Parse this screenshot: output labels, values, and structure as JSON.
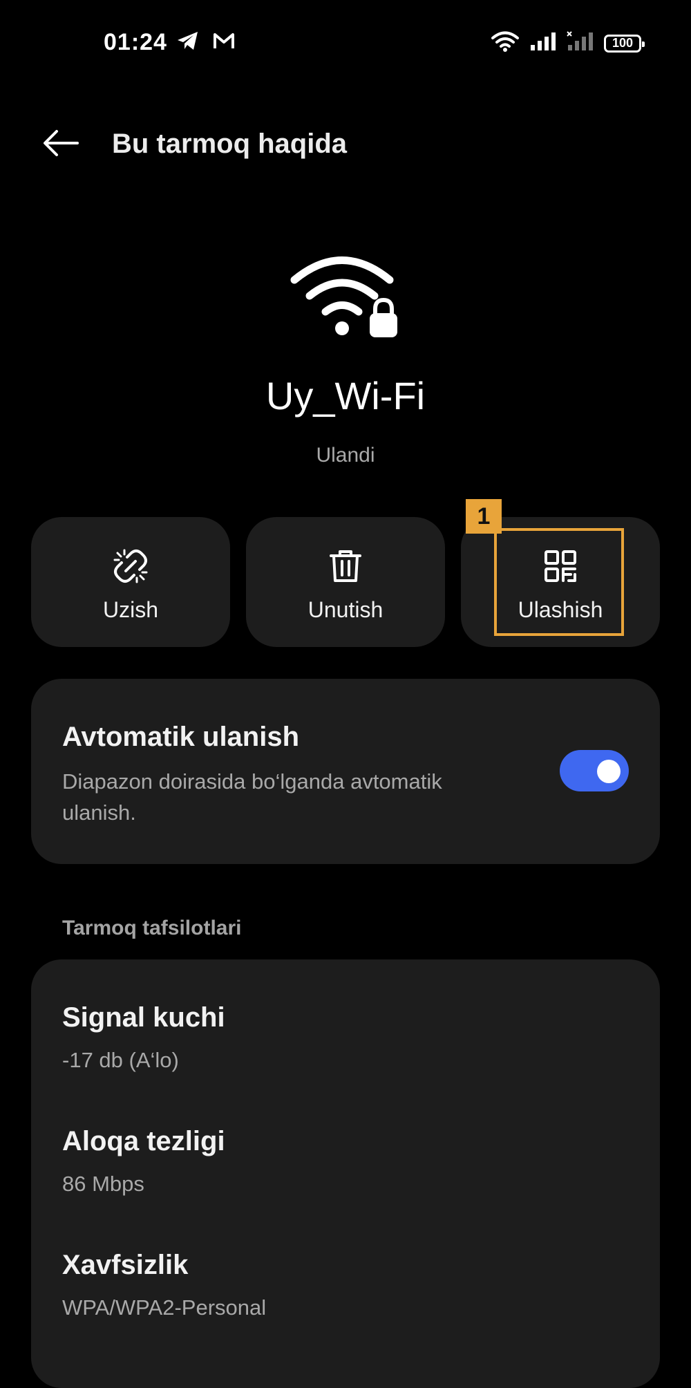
{
  "status_bar": {
    "time": "01:24",
    "battery": "100",
    "left_icons": [
      "telegram-icon",
      "gmail-icon"
    ],
    "right_icons": [
      "wifi-icon",
      "signal-icon",
      "signal-nosim-icon",
      "battery-icon"
    ]
  },
  "header": {
    "title": "Bu tarmoq haqida"
  },
  "network": {
    "icon": "wifi-lock-icon",
    "name": "Uy_Wi-Fi",
    "status": "Ulandi"
  },
  "actions": [
    {
      "label": "Uzish",
      "icon": "unlink-icon"
    },
    {
      "label": "Unutish",
      "icon": "trash-icon"
    },
    {
      "label": "Ulashish",
      "icon": "qr-code-icon"
    }
  ],
  "annotation": {
    "number": "1",
    "color": "#e8a43a"
  },
  "auto_connect": {
    "title": "Avtomatik ulanish",
    "description": "Diapazon doirasida bo‘lganda avtomatik ulanish.",
    "enabled": true,
    "accent": "#3f68f0"
  },
  "details": {
    "section_title": "Tarmoq tafsilotlari",
    "items": [
      {
        "title": "Signal kuchi",
        "value": "-17 db (A‘lo)"
      },
      {
        "title": "Aloqa tezligi",
        "value": "86 Mbps"
      },
      {
        "title": "Xavfsizlik",
        "value": "WPA/WPA2-Personal"
      }
    ]
  }
}
